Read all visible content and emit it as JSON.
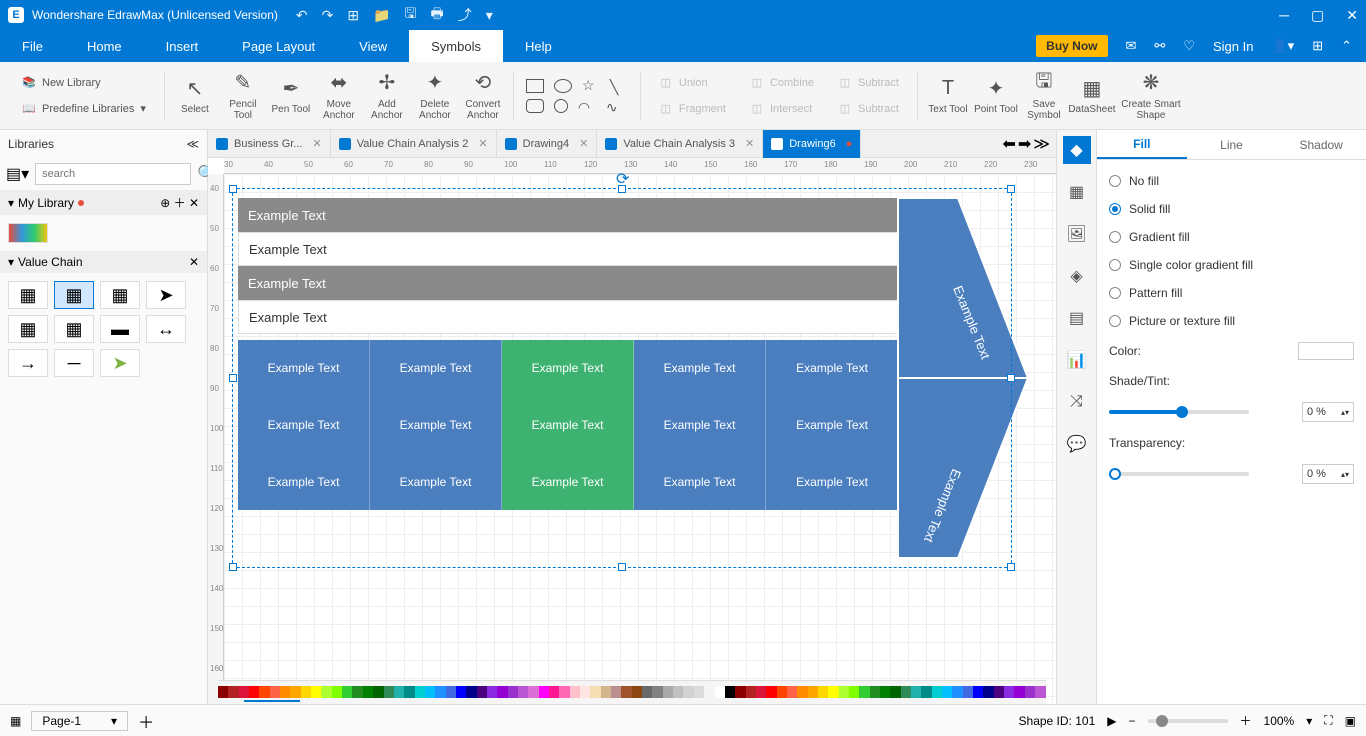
{
  "title": "Wondershare EdrawMax (Unlicensed Version)",
  "menus": [
    "File",
    "Home",
    "Insert",
    "Page Layout",
    "View",
    "Symbols",
    "Help"
  ],
  "activeMenu": "Symbols",
  "buyNow": "Buy Now",
  "signIn": "Sign In",
  "ribbon": {
    "newLibrary": "New Library",
    "predefine": "Predefine Libraries",
    "select": "Select",
    "pencil": "Pencil\nTool",
    "pen": "Pen\nTool",
    "move": "Move\nAnchor",
    "add": "Add\nAnchor",
    "del": "Delete\nAnchor",
    "convert": "Convert\nAnchor",
    "union": "Union",
    "combine": "Combine",
    "subtract": "Subtract",
    "fragment": "Fragment",
    "intersect": "Intersect",
    "subtract2": "Subtract",
    "text": "Text\nTool",
    "point": "Point\nTool",
    "save": "Save\nSymbol",
    "datasheet": "DataSheet",
    "smart": "Create Smart\nShape"
  },
  "libraries": {
    "header": "Libraries",
    "searchPlaceholder": "search",
    "myLibrary": "My Library",
    "valueChain": "Value Chain"
  },
  "tabs": [
    {
      "label": "Business Gr...",
      "active": false
    },
    {
      "label": "Value Chain Analysis 2",
      "active": false
    },
    {
      "label": "Drawing4",
      "active": false
    },
    {
      "label": "Value Chain Analysis 3",
      "active": false
    },
    {
      "label": "Drawing6",
      "active": true,
      "dirty": true
    }
  ],
  "diagram": {
    "rows": [
      "Example Text",
      "Example Text",
      "Example Text",
      "Example Text"
    ],
    "arrowText": [
      "Example Text",
      "Example Text"
    ],
    "cell": "Example Text"
  },
  "propPanel": {
    "tabs": [
      "Fill",
      "Line",
      "Shadow"
    ],
    "activeTab": "Fill",
    "options": [
      "No fill",
      "Solid fill",
      "Gradient fill",
      "Single color gradient fill",
      "Pattern fill",
      "Picture or texture fill"
    ],
    "selected": "Solid fill",
    "colorLabel": "Color:",
    "shadeLabel": "Shade/Tint:",
    "shadeValue": "0 %",
    "transLabel": "Transparency:",
    "transValue": "0 %"
  },
  "status": {
    "page": "Page-1",
    "pageTab": "Page-1",
    "shapeId": "Shape ID: 101",
    "zoom": "100%"
  },
  "rulerH": [
    30,
    40,
    50,
    60,
    70,
    80,
    90,
    100,
    110,
    120,
    130,
    140,
    150,
    160,
    170,
    180,
    190,
    200,
    210,
    220,
    230
  ],
  "rulerV": [
    40,
    50,
    60,
    70,
    80,
    90,
    100,
    110,
    120,
    130,
    140,
    150,
    160
  ]
}
